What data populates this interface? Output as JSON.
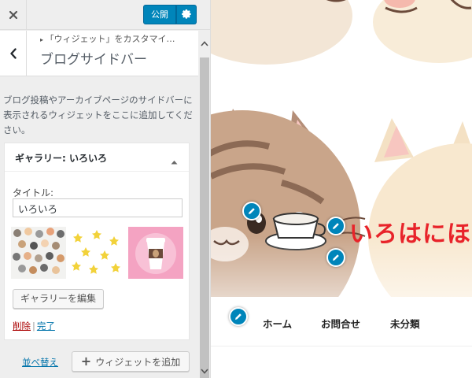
{
  "header": {
    "publish_label": "公開"
  },
  "section": {
    "breadcrumb": "「ウィジェット」をカスタマイ…",
    "title": "ブログサイドバー",
    "description": "ブログ投稿やアーカイブページのサイドバーに表示されるウィジェットをここに追加してください。"
  },
  "widget": {
    "title": "ギャラリー: いろいろ",
    "title_field_label": "タイトル:",
    "title_field_value": "いろいろ",
    "edit_gallery_label": "ギャラリーを編集",
    "delete_label": "削除",
    "separator": "|",
    "done_label": "完了"
  },
  "footer": {
    "reorder_label": "並べ替え",
    "add_widget_label": "ウィジェットを追加"
  },
  "preview": {
    "site_title": "いろはにほ",
    "nav": [
      "ホーム",
      "お問合せ",
      "未分類"
    ]
  },
  "colors": {
    "accent": "#0085ba",
    "site_title": "#e8232a",
    "delete": "#aa0000",
    "link": "#0073aa"
  }
}
